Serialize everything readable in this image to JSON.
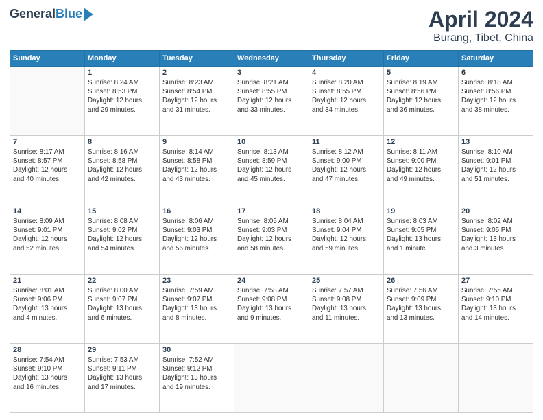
{
  "logo": {
    "general": "General",
    "blue": "Blue"
  },
  "title": "April 2024",
  "subtitle": "Burang, Tibet, China",
  "days_of_week": [
    "Sunday",
    "Monday",
    "Tuesday",
    "Wednesday",
    "Thursday",
    "Friday",
    "Saturday"
  ],
  "weeks": [
    [
      null,
      {
        "num": "1",
        "sunrise": "8:24 AM",
        "sunset": "8:53 PM",
        "daylight": "12 hours and 29 minutes."
      },
      {
        "num": "2",
        "sunrise": "8:23 AM",
        "sunset": "8:54 PM",
        "daylight": "12 hours and 31 minutes."
      },
      {
        "num": "3",
        "sunrise": "8:21 AM",
        "sunset": "8:55 PM",
        "daylight": "12 hours and 33 minutes."
      },
      {
        "num": "4",
        "sunrise": "8:20 AM",
        "sunset": "8:55 PM",
        "daylight": "12 hours and 34 minutes."
      },
      {
        "num": "5",
        "sunrise": "8:19 AM",
        "sunset": "8:56 PM",
        "daylight": "12 hours and 36 minutes."
      },
      {
        "num": "6",
        "sunrise": "8:18 AM",
        "sunset": "8:56 PM",
        "daylight": "12 hours and 38 minutes."
      }
    ],
    [
      {
        "num": "7",
        "sunrise": "8:17 AM",
        "sunset": "8:57 PM",
        "daylight": "12 hours and 40 minutes."
      },
      {
        "num": "8",
        "sunrise": "8:16 AM",
        "sunset": "8:58 PM",
        "daylight": "12 hours and 42 minutes."
      },
      {
        "num": "9",
        "sunrise": "8:14 AM",
        "sunset": "8:58 PM",
        "daylight": "12 hours and 43 minutes."
      },
      {
        "num": "10",
        "sunrise": "8:13 AM",
        "sunset": "8:59 PM",
        "daylight": "12 hours and 45 minutes."
      },
      {
        "num": "11",
        "sunrise": "8:12 AM",
        "sunset": "9:00 PM",
        "daylight": "12 hours and 47 minutes."
      },
      {
        "num": "12",
        "sunrise": "8:11 AM",
        "sunset": "9:00 PM",
        "daylight": "12 hours and 49 minutes."
      },
      {
        "num": "13",
        "sunrise": "8:10 AM",
        "sunset": "9:01 PM",
        "daylight": "12 hours and 51 minutes."
      }
    ],
    [
      {
        "num": "14",
        "sunrise": "8:09 AM",
        "sunset": "9:01 PM",
        "daylight": "12 hours and 52 minutes."
      },
      {
        "num": "15",
        "sunrise": "8:08 AM",
        "sunset": "9:02 PM",
        "daylight": "12 hours and 54 minutes."
      },
      {
        "num": "16",
        "sunrise": "8:06 AM",
        "sunset": "9:03 PM",
        "daylight": "12 hours and 56 minutes."
      },
      {
        "num": "17",
        "sunrise": "8:05 AM",
        "sunset": "9:03 PM",
        "daylight": "12 hours and 58 minutes."
      },
      {
        "num": "18",
        "sunrise": "8:04 AM",
        "sunset": "9:04 PM",
        "daylight": "12 hours and 59 minutes."
      },
      {
        "num": "19",
        "sunrise": "8:03 AM",
        "sunset": "9:05 PM",
        "daylight": "13 hours and 1 minute."
      },
      {
        "num": "20",
        "sunrise": "8:02 AM",
        "sunset": "9:05 PM",
        "daylight": "13 hours and 3 minutes."
      }
    ],
    [
      {
        "num": "21",
        "sunrise": "8:01 AM",
        "sunset": "9:06 PM",
        "daylight": "13 hours and 4 minutes."
      },
      {
        "num": "22",
        "sunrise": "8:00 AM",
        "sunset": "9:07 PM",
        "daylight": "13 hours and 6 minutes."
      },
      {
        "num": "23",
        "sunrise": "7:59 AM",
        "sunset": "9:07 PM",
        "daylight": "13 hours and 8 minutes."
      },
      {
        "num": "24",
        "sunrise": "7:58 AM",
        "sunset": "9:08 PM",
        "daylight": "13 hours and 9 minutes."
      },
      {
        "num": "25",
        "sunrise": "7:57 AM",
        "sunset": "9:08 PM",
        "daylight": "13 hours and 11 minutes."
      },
      {
        "num": "26",
        "sunrise": "7:56 AM",
        "sunset": "9:09 PM",
        "daylight": "13 hours and 13 minutes."
      },
      {
        "num": "27",
        "sunrise": "7:55 AM",
        "sunset": "9:10 PM",
        "daylight": "13 hours and 14 minutes."
      }
    ],
    [
      {
        "num": "28",
        "sunrise": "7:54 AM",
        "sunset": "9:10 PM",
        "daylight": "13 hours and 16 minutes."
      },
      {
        "num": "29",
        "sunrise": "7:53 AM",
        "sunset": "9:11 PM",
        "daylight": "13 hours and 17 minutes."
      },
      {
        "num": "30",
        "sunrise": "7:52 AM",
        "sunset": "9:12 PM",
        "daylight": "13 hours and 19 minutes."
      },
      null,
      null,
      null,
      null
    ]
  ]
}
